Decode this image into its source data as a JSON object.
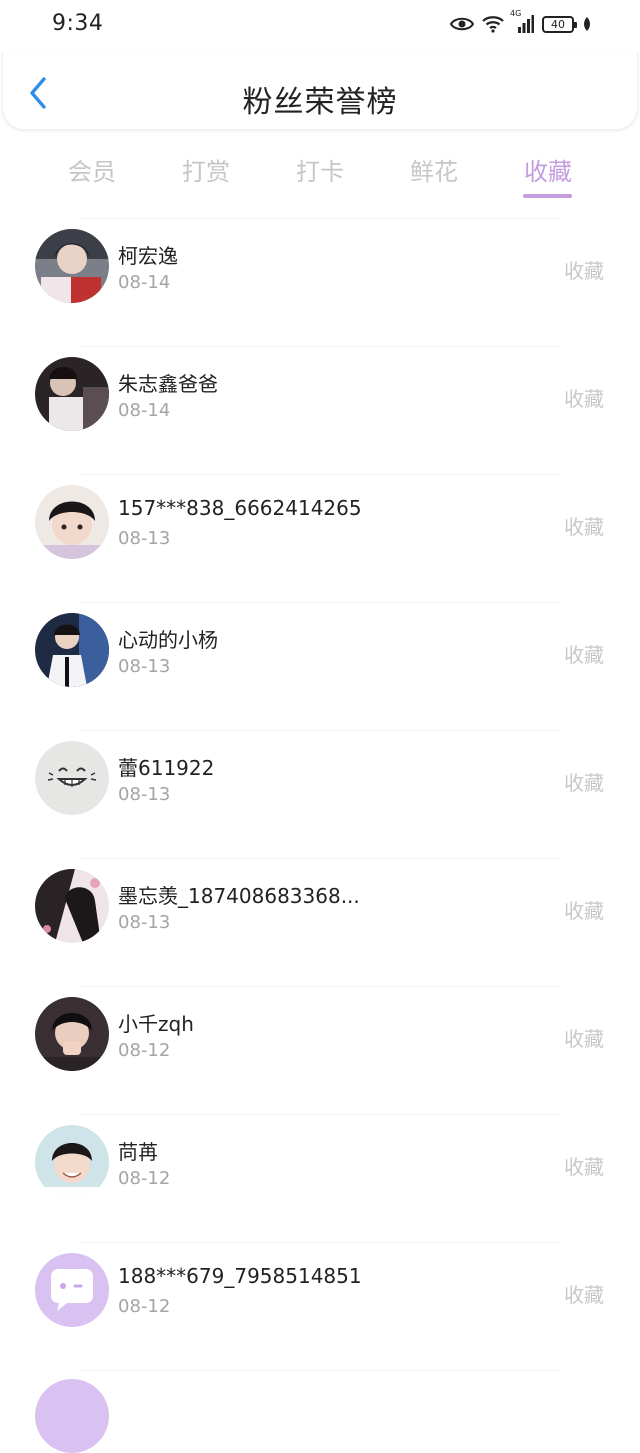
{
  "status_bar": {
    "time": "9:34",
    "network": "4G",
    "battery": "40"
  },
  "header": {
    "title": "粉丝荣誉榜"
  },
  "tabs": [
    {
      "label": "会员"
    },
    {
      "label": "打赏"
    },
    {
      "label": "打卡"
    },
    {
      "label": "鲜花"
    },
    {
      "label": "收藏"
    }
  ],
  "active_tab": "收藏",
  "list": [
    {
      "name": "柯宏逸",
      "date": "08-14",
      "action": "收藏"
    },
    {
      "name": "朱志鑫爸爸",
      "date": "08-14",
      "action": "收藏"
    },
    {
      "name": "157***838_6662414265",
      "date": "08-13",
      "action": "收藏"
    },
    {
      "name": "心动的小杨",
      "date": "08-13",
      "action": "收藏"
    },
    {
      "name": "蕾611922",
      "date": "08-13",
      "action": "收藏"
    },
    {
      "name": "墨忘羡_187408683368...",
      "date": "08-13",
      "action": "收藏"
    },
    {
      "name": "小千zqh",
      "date": "08-12",
      "action": "收藏"
    },
    {
      "name": "苘苒",
      "date": "08-12",
      "action": "收藏"
    },
    {
      "name": "188***679_7958514851",
      "date": "08-12",
      "action": "收藏"
    }
  ],
  "colors": {
    "accent": "#c49de0",
    "back_arrow": "#2f8fe8",
    "inactive_tab": "#c6c6c6",
    "date_text": "#a4a4a4"
  }
}
